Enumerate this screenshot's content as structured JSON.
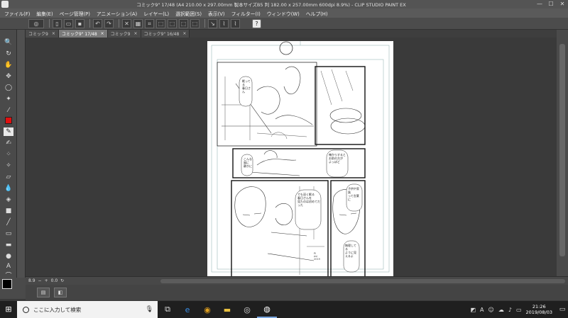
{
  "window": {
    "title": "コミック9\" 17/48 (A4 210.00 x 297.00mm 製本サイズB5 判 182.00 x 257.00mm 600dpi 8.9%) - CLIP STUDIO PAINT EX",
    "minimize": "—",
    "maximize": "☐",
    "close": "✕"
  },
  "menu": [
    "ファイル(F)",
    "編集(E)",
    "ページ管理(P)",
    "アニメーション(A)",
    "レイヤー(L)",
    "選択範囲(S)",
    "表示(V)",
    "フィルター(I)",
    "ウィンドウ(W)",
    "ヘルプ(H)"
  ],
  "command_bar": {
    "help": "?"
  },
  "tabs": [
    {
      "label": "コミック9",
      "active": false
    },
    {
      "label": "コミック9\" 17/48",
      "active": true
    },
    {
      "label": "コミック9",
      "active": false
    },
    {
      "label": "コミック9\" 16/48",
      "active": false
    }
  ],
  "tab_close": "×",
  "navigator": {
    "zoom": "8.9",
    "angle": "0.0"
  },
  "taskbar": {
    "search_placeholder": "ここに入力して検索",
    "time": "21:26",
    "date": "2019/08/03",
    "ime": "A"
  },
  "manga": {
    "balloon1": "眠ってる\n春日さん",
    "balloon2": "こんな風に\n静かに",
    "balloon3": "俺からすると\nお前の方が\nよっぽど",
    "balloon4": "でも深く眠る\n春日さんを\n見たのは初めてだった",
    "balloon5": "子供や家族\nって言葉に",
    "balloon6": "無理してる\nように見えるよ",
    "sign": "Pi\nevi\n2019"
  },
  "colors": {
    "ui_dark": "#3a3a3a",
    "accent_red": "#e01010",
    "title_bg": "#545454"
  }
}
